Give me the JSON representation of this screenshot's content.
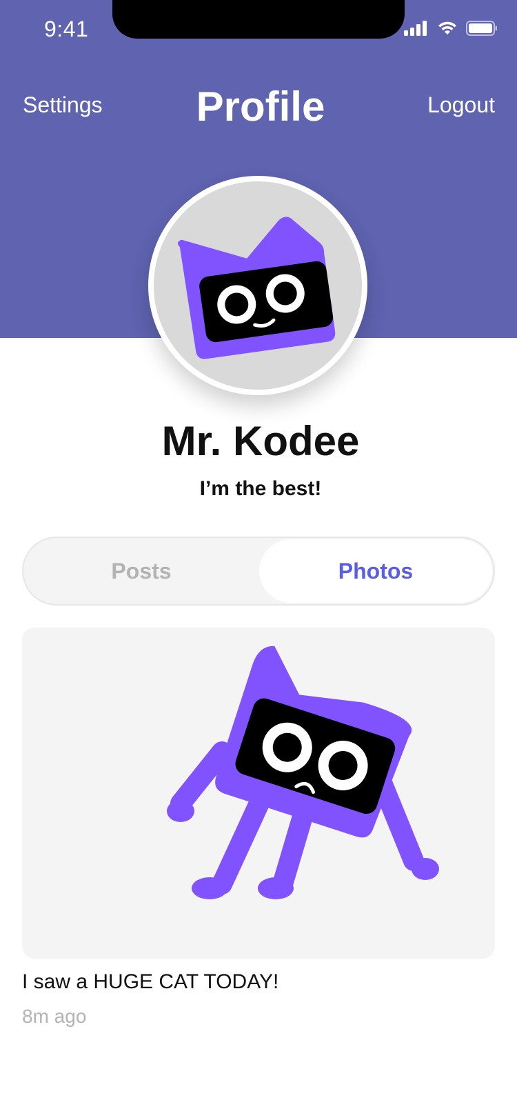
{
  "status_bar": {
    "time": "9:41"
  },
  "nav": {
    "left": "Settings",
    "title": "Profile",
    "right": "Logout"
  },
  "profile": {
    "name": "Mr. Kodee",
    "bio": "I’m the best!"
  },
  "tabs": [
    {
      "label": "Posts",
      "selected": false
    },
    {
      "label": "Photos",
      "selected": true
    }
  ],
  "post": {
    "caption": "I saw a HUGE CAT TODAY!",
    "time_ago": "8m ago"
  },
  "colors": {
    "header": "#5f63b0",
    "accent": "#5a5ee6",
    "mascot": "#8053ff",
    "card": "#f4f4f4"
  },
  "icons": [
    "signal-icon",
    "wifi-icon",
    "battery-icon"
  ]
}
